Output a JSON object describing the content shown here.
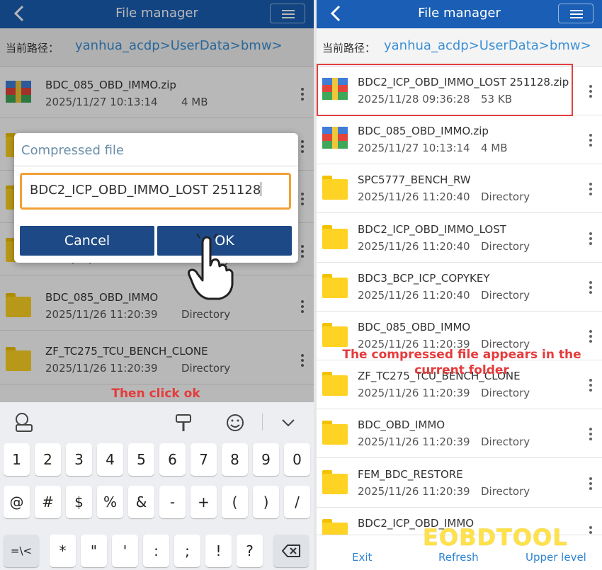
{
  "left": {
    "title": "File manager",
    "path_label": "当前路径：",
    "path_value": "yanhua_acdp>UserData>bmw>",
    "files": [
      {
        "name": "BDC_085_OBD_IMMO.zip",
        "date": "2025/11/27 10:13:14",
        "meta": "4 MB",
        "type": "zip"
      },
      {
        "name": "",
        "date": "",
        "meta": "",
        "type": "folder"
      },
      {
        "name": "",
        "date": "",
        "meta": "",
        "type": "folder"
      },
      {
        "name": "",
        "date": "2025/11/26 11:20:40",
        "meta": "Directory",
        "type": "folder"
      },
      {
        "name": "BDC_085_OBD_IMMO",
        "date": "2025/11/26 11:20:39",
        "meta": "Directory",
        "type": "folder"
      },
      {
        "name": "ZF_TC275_TCU_BENCH_CLONE",
        "date": "2025/11/26 11:20:39",
        "meta": "Directory",
        "type": "folder"
      }
    ],
    "dialog": {
      "title": "Compressed file",
      "input_value": "BDC2_ICP_OBD_IMMO_LOST 251128",
      "cancel_label": "Cancel",
      "ok_label": "OK"
    },
    "note": "Then click ok",
    "keyboard": {
      "row1": [
        "1",
        "2",
        "3",
        "4",
        "5",
        "6",
        "7",
        "8",
        "9",
        "0"
      ],
      "row2": [
        "@",
        "#",
        "$",
        "%",
        "&",
        "-",
        "+",
        "(",
        ")",
        "/"
      ],
      "row3": [
        "=\\<",
        "*",
        "\"",
        "'",
        ":",
        ";",
        "!",
        "?"
      ]
    }
  },
  "right": {
    "title": "File manager",
    "path_label": "当前路径：",
    "path_value": "yanhua_acdp>UserData>bmw>",
    "files": [
      {
        "name": "BDC2_ICP_OBD_IMMO_LOST 251128.zip",
        "date": "2025/11/28 09:36:28",
        "meta": "53 KB",
        "type": "zip"
      },
      {
        "name": "BDC_085_OBD_IMMO.zip",
        "date": "2025/11/27 10:13:14",
        "meta": "4 MB",
        "type": "zip"
      },
      {
        "name": "SPC5777_BENCH_RW",
        "date": "2025/11/26 11:20:40",
        "meta": "Directory",
        "type": "folder"
      },
      {
        "name": "BDC2_ICP_OBD_IMMO_LOST",
        "date": "2025/11/26 11:20:40",
        "meta": "Directory",
        "type": "folder"
      },
      {
        "name": "BDC3_BCP_ICP_COPYKEY",
        "date": "2025/11/26 11:20:40",
        "meta": "Directory",
        "type": "folder"
      },
      {
        "name": "BDC_085_OBD_IMMO",
        "date": "2025/11/26 11:20:39",
        "meta": "Directory",
        "type": "folder"
      },
      {
        "name": "ZF_TC275_TCU_BENCH_CLONE",
        "date": "2025/11/26 11:20:39",
        "meta": "Directory",
        "type": "folder"
      },
      {
        "name": "BDC_OBD_IMMO",
        "date": "2025/11/26 11:20:39",
        "meta": "Directory",
        "type": "folder"
      },
      {
        "name": "FEM_BDC_RESTORE",
        "date": "2025/11/26 11:20:39",
        "meta": "Directory",
        "type": "folder"
      },
      {
        "name": "BDC2_ICP_OBD_IMMO",
        "date": "",
        "meta": "",
        "type": "folder"
      }
    ],
    "note": "The compressed file appears in the current folder",
    "bottom": {
      "exit": "Exit",
      "refresh": "Refresh",
      "upper": "Upper level"
    }
  },
  "watermark": "EOBDTOOL",
  "colors": {
    "titlebar": "#1a5fb5",
    "accent": "#3a8fd6",
    "note": "#e53b3b",
    "button": "#1d4a86",
    "input_border": "#f2a035"
  }
}
